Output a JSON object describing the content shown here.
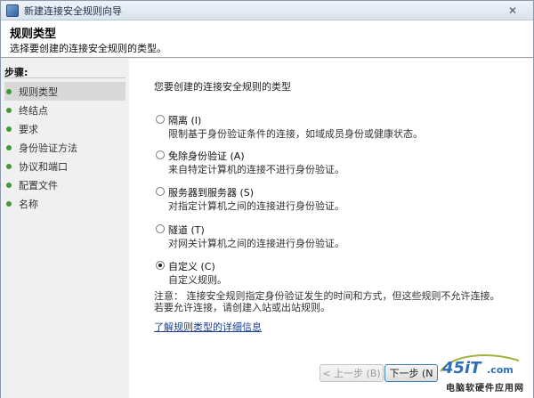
{
  "window": {
    "title": "新建连接安全规则向导",
    "close_glyph": "✕"
  },
  "header": {
    "title": "规则类型",
    "subtitle": "选择要创建的连接安全规则的类型。"
  },
  "sidebar": {
    "steps_label": "步骤:",
    "items": [
      {
        "label": "规则类型",
        "active": true
      },
      {
        "label": "终结点"
      },
      {
        "label": "要求"
      },
      {
        "label": "身份验证方法"
      },
      {
        "label": "协议和端口"
      },
      {
        "label": "配置文件"
      },
      {
        "label": "名称"
      }
    ]
  },
  "content": {
    "question": "您要创建的连接安全规则的类型",
    "options": [
      {
        "label": "隔离 (I)",
        "desc": "限制基于身份验证条件的连接，如域成员身份或健康状态。",
        "checked": false
      },
      {
        "label": "免除身份验证 (A)",
        "desc": "来自特定计算机的连接不进行身份验证。",
        "checked": false
      },
      {
        "label": "服务器到服务器 (S)",
        "desc": "对指定计算机之间的连接进行身份验证。",
        "checked": false
      },
      {
        "label": "隧道 (T)",
        "desc": "对网关计算机之间的连接进行身份验证。",
        "checked": false
      },
      {
        "label": "自定义 (C)",
        "desc": "自定义规则。",
        "checked": true
      }
    ],
    "note": "注意：  连接安全规则指定身份验证发生的时间和方式，但这些规则不允许连接。若要允许连接，请创建入站或出站规则。",
    "learn_link": "了解规则类型的详细信息"
  },
  "buttons": {
    "back": "< 上一步 (B)",
    "next": "下一步 (N"
  },
  "watermark": {
    "logo": "45iT.com",
    "text": "电脑软硬件应用网"
  },
  "colors": {
    "accent_dot": "#3d9a35",
    "link": "#1c3f94"
  }
}
